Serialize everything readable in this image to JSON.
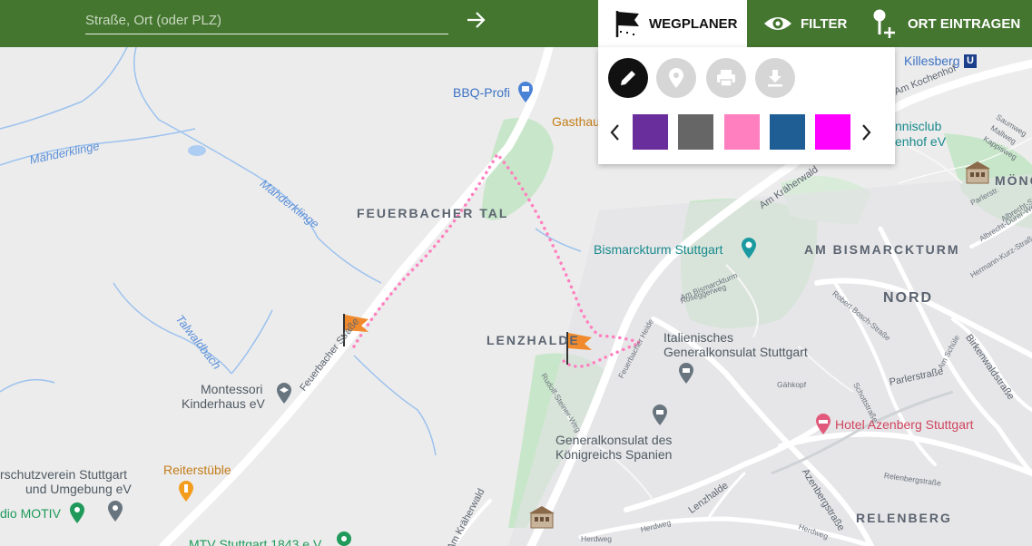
{
  "search": {
    "placeholder": "Straße, Ort (oder PLZ)",
    "value": "",
    "go_icon": "arrow-right-icon"
  },
  "tabs": [
    {
      "label": "WEGPLANER",
      "icon": "flag-icon",
      "active": true
    },
    {
      "label": "FILTER",
      "icon": "eye-icon",
      "active": false
    },
    {
      "label": "ORT EINTRAGEN",
      "icon": "add-location-icon",
      "active": false
    }
  ],
  "planner": {
    "tools": [
      {
        "name": "edit",
        "icon": "pencil-icon",
        "active": true
      },
      {
        "name": "pin",
        "icon": "location-pin-icon",
        "active": false
      },
      {
        "name": "print",
        "icon": "printer-icon",
        "active": false
      },
      {
        "name": "download",
        "icon": "download-icon",
        "active": false
      }
    ],
    "colors": [
      "#6a2e9c",
      "#666666",
      "#ff7fbf",
      "#1e5e94",
      "#ff00ff"
    ]
  },
  "map": {
    "districts": {
      "feuerbacher_tal": "FEUERBACHER TAL",
      "am_bismarckturm": "AM BISMARCKTURM",
      "nord": "NORD",
      "lenzhalde": "LENZHALDE",
      "relenberg": "RELENBERG",
      "moench": "MÖNC"
    },
    "pois": {
      "bbq_profi": "BBQ-Profi",
      "gasthaus": "Gasthau",
      "killesberg": "Killesberg",
      "u_badge": "U",
      "am_kochenhof": "Am Kochenhof",
      "tennisclub_1": "nnisclub",
      "tennisclub_2": "enhof eV",
      "bismarckturm": "Bismarckturm Stuttgart",
      "italienisches_1": "Italienisches",
      "italienisches_2": "Generalkonsulat Stuttgart",
      "spanien_1": "Generalkonsulat des",
      "spanien_2": "Königreichs Spanien",
      "montessori_1": "Montessori",
      "montessori_2": "Kinderhaus eV",
      "reiterstueble": "Reiterstüble",
      "verein_1": "rschutzverein Stuttgart",
      "verein_2": "und Umgebung eV",
      "studio": "dio MOTIV",
      "mtv": "MTV Stuttgart 1843 e.V.",
      "hotel": "Hotel Azenberg Stuttgart"
    },
    "water": {
      "maehderklinge_1": "Mähderklinge",
      "maehderklinge_2": "Mähderklinge",
      "talwaldbach": "Talwaldbach"
    },
    "streets": {
      "feuerbacher_strasse": "Feuerbacher Straße",
      "am_kraeherwald": "Am Kräherwald",
      "am_kraeherwald_2": "Am Kräherwald",
      "am_bismarckturm": "Am Bismarckturm",
      "roseggerweg": "Roseggerweg",
      "feuerbacher_heide": "Feuerbacher Heide",
      "rudolf_steiner_weg": "Rudolf-Steiner-Weg",
      "robert_bosch_strasse": "Robert-Bosch-Straße",
      "parlerstrasse": "Parlerstraße",
      "parlerstrasse_2": "Parlerstr.",
      "birkenwaldstrasse": "Birkenwaldstraße",
      "am_schuele": "Am Schüle",
      "gaehkopf": "Gähkopf",
      "schottstrasse": "Schottstraße",
      "lenzhalde": "Lenzhalde",
      "herdweg": "Herdweg",
      "herdweg_2": "Herdweg",
      "herdweg_3": "Herdweg",
      "azenbergstrasse": "Azenbergstraße",
      "relenbergstrasse": "Relenbergstraße",
      "saumweg": "Saumweg",
      "mallweg": "Mallweg",
      "kappisweg": "Kappisweg",
      "albrecht_duerer_weg": "Albrecht-Dürer-Weg",
      "hermann_kurz_strasse": "Hermann-Kurz-Straße",
      "albrecht_strasse": "Albrecht-Straße"
    },
    "route": {
      "color": "#ff7fbf",
      "style": "dotted"
    },
    "route_markers": [
      "flag-marker-icon",
      "flag-marker-icon"
    ],
    "route_marker_color": "#f08a2c"
  }
}
